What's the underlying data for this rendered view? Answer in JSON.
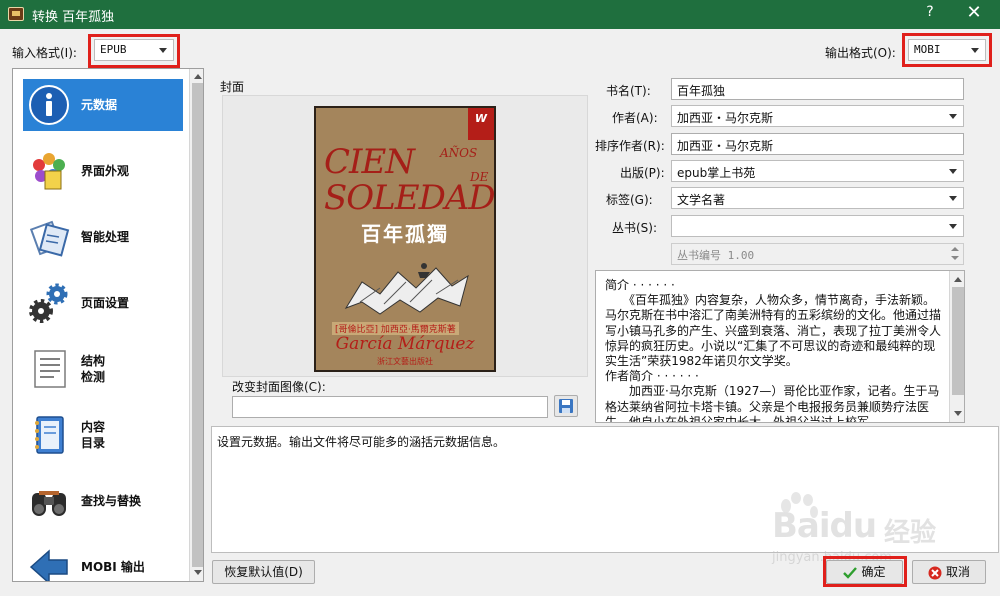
{
  "window": {
    "title": "转换 百年孤独",
    "help_label": "?",
    "close_label": "✕"
  },
  "input_format": {
    "label": "输入格式(I):",
    "value": "EPUB"
  },
  "output_format": {
    "label": "输出格式(O):",
    "value": "MOBI"
  },
  "sidebar": {
    "items": [
      {
        "label": "元数据",
        "icon": "info-icon",
        "active": true
      },
      {
        "label": "界面外观",
        "icon": "appearance-icon"
      },
      {
        "label": "智能处理",
        "icon": "heuristics-icon"
      },
      {
        "label": "页面设置",
        "icon": "page-setup-gear-icon"
      },
      {
        "label": "结构\n检测",
        "icon": "structure-document-icon"
      },
      {
        "label": "内容\n目录",
        "icon": "toc-notebook-icon"
      },
      {
        "label": "查找与替换",
        "icon": "binoculars-icon"
      },
      {
        "label": "MOBI 输出",
        "icon": "output-arrow-icon"
      }
    ]
  },
  "cover": {
    "label": "封面",
    "change_label": "改变封面图像(C):",
    "path_value": "",
    "image_text": {
      "ribbon": "W",
      "title_1": "CIEN",
      "title_1_small": "AÑOS",
      "title_2": "SOLEDAD",
      "title_2_small": "DE",
      "chinese_title": "百年孤獨",
      "author_strip": "[哥倫比亞] 加西亞·馬爾克斯著",
      "author": "García Márquez",
      "publisher": "浙江文藝出版社"
    }
  },
  "metadata": {
    "title": {
      "label": "书名(T):",
      "value": "百年孤独"
    },
    "author": {
      "label": "作者(A):",
      "value": "加西亚・马尔克斯"
    },
    "author_sort": {
      "label": "排序作者(R):",
      "value": "加西亚・马尔克斯"
    },
    "publisher": {
      "label": "出版(P):",
      "value": "epub掌上书苑"
    },
    "tags": {
      "label": "标签(G):",
      "value": "文学名著"
    },
    "series": {
      "label": "丛书(S):",
      "value": ""
    },
    "series_index": {
      "value": "丛书编号 1.00"
    }
  },
  "summary": {
    "paragraphs": [
      "简介 · · · · · ·",
      "　　《百年孤独》内容复杂，人物众多，情节离奇，手法新颖。马尔克斯在书中溶汇了南美洲特有的五彩缤纷的文化。他通过描写小镇马孔多的产生、兴盛到衰落、消亡，表现了拉丁美洲令人惊异的疯狂历史。小说以“汇集了不可思议的奇迹和最纯粹的现实生活”荣获1982年诺贝尔文学奖。",
      "作者简介 · · · · · ·",
      "　　加西亚·马尔克斯（1927—）哥伦比亚作家，记者。生于马格达莱纳省阿拉卡塔卡镇。父亲是个电报报务员兼顺势疗法医生。他自小在外祖父家中长大。外祖父当过上校军"
    ]
  },
  "description": {
    "text": "设置元数据。输出文件将尽可能多的涵括元数据信息。"
  },
  "buttons": {
    "restore": "恢复默认值(D)",
    "ok": "确定",
    "cancel": "取消"
  },
  "watermark": {
    "brand": "Baidu",
    "cn": "经验",
    "url": "jingyan.baidu.com"
  },
  "colors": {
    "titlebar": "#1f6f3e",
    "highlight": "#e0201b",
    "active": "#2a82d6"
  }
}
